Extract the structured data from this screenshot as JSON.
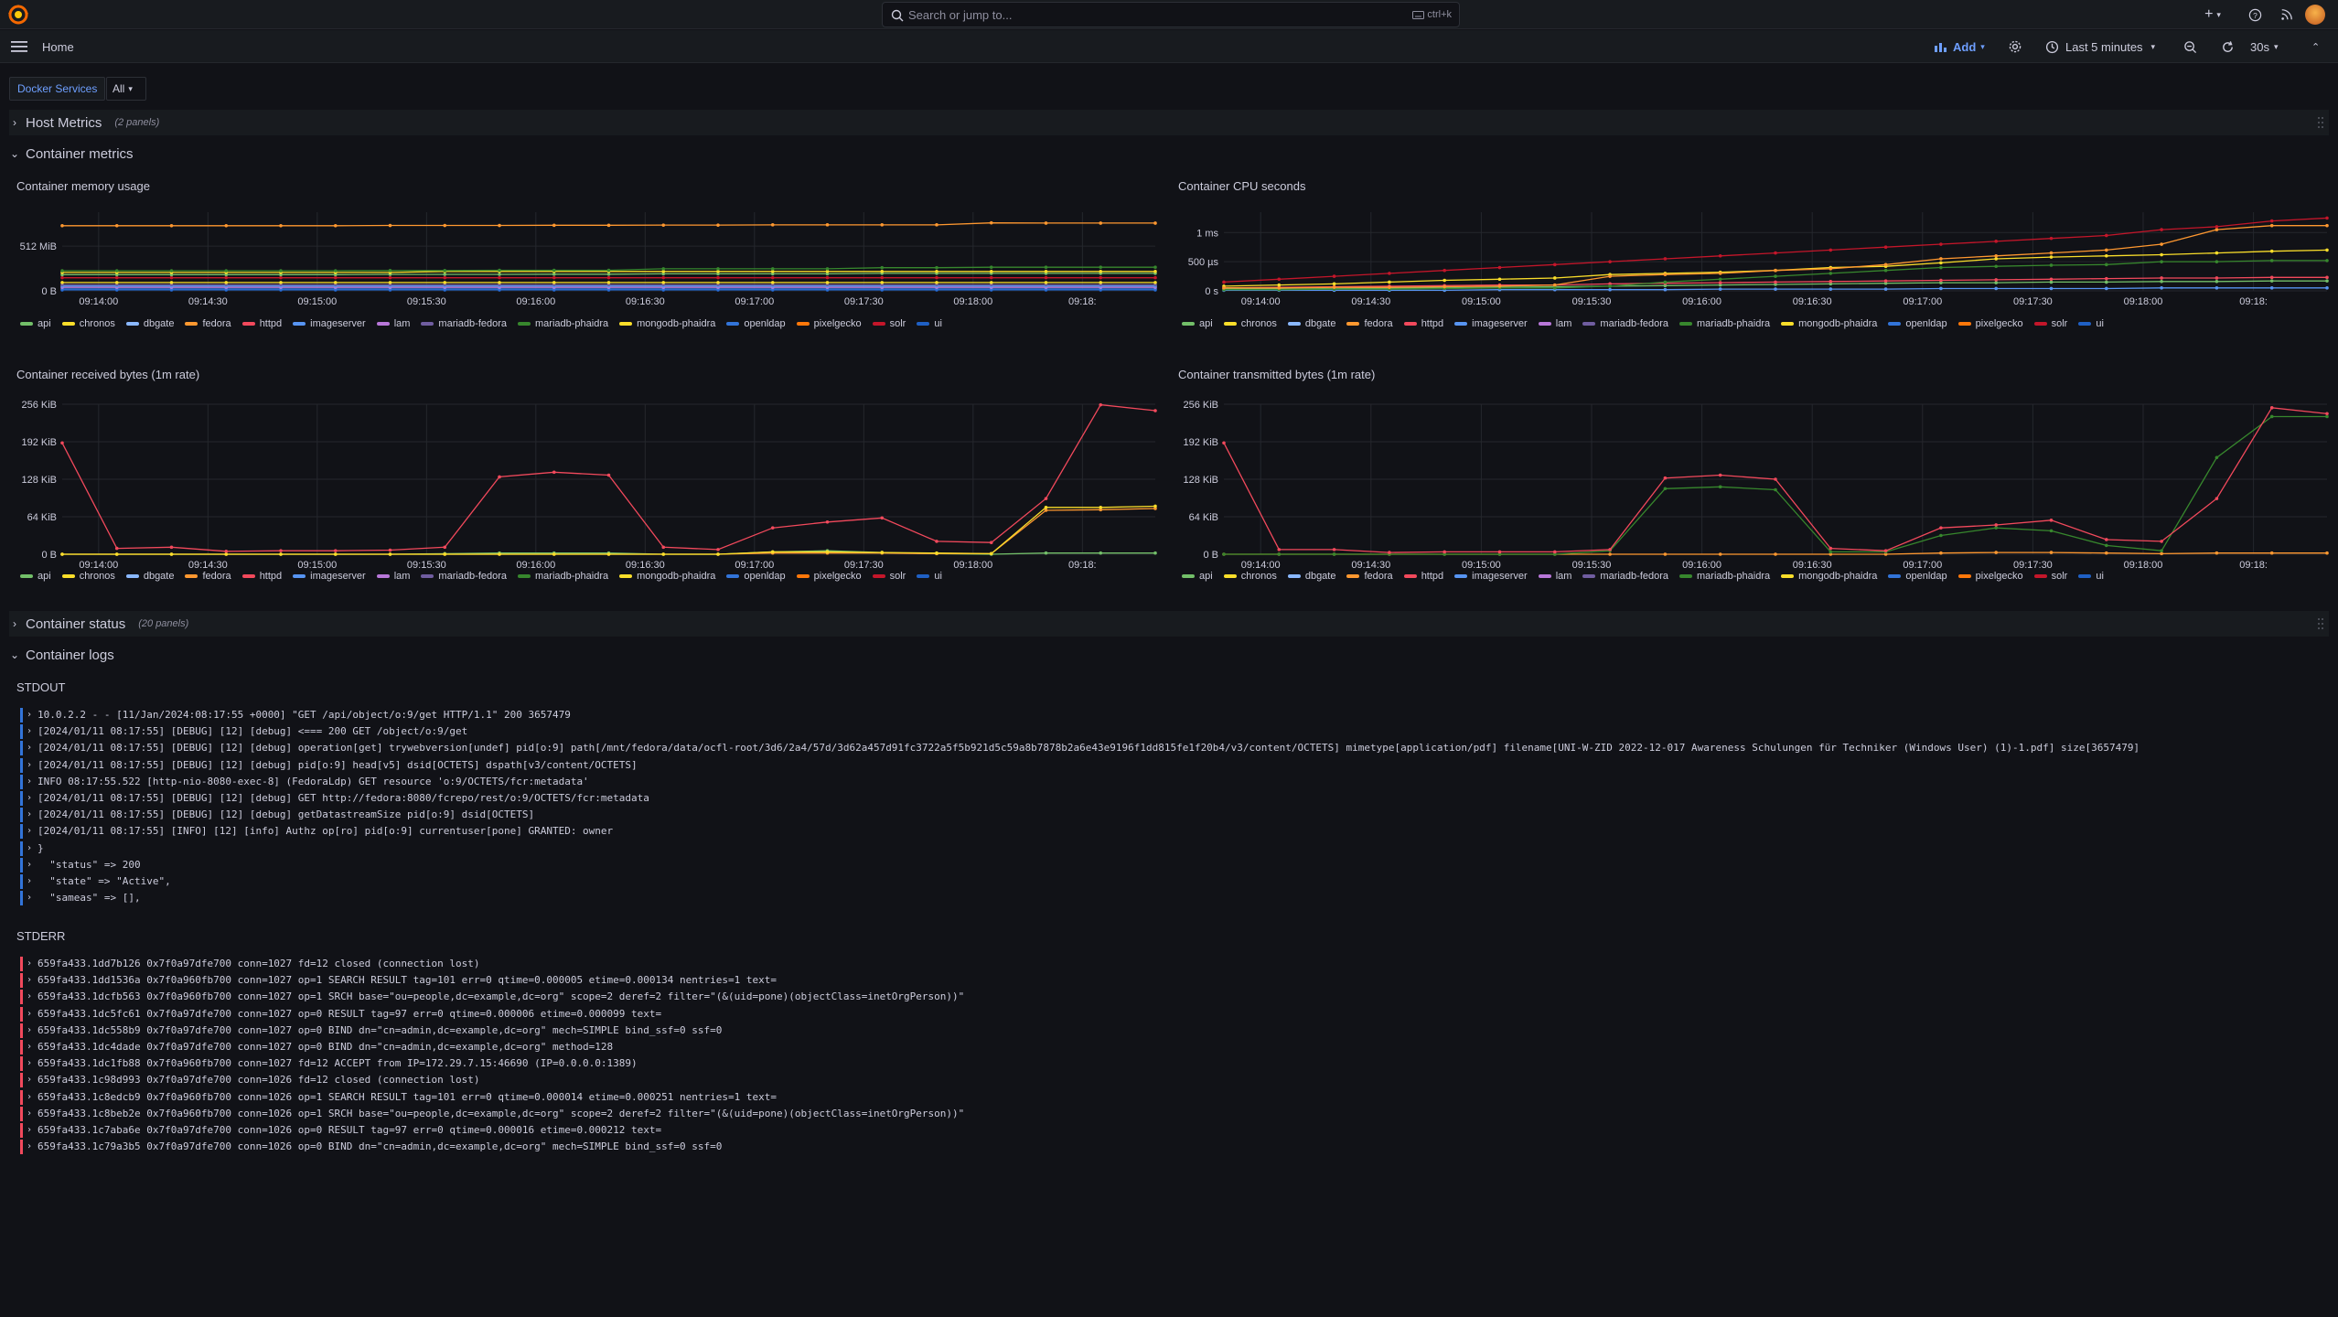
{
  "topbar": {
    "search_placeholder": "Search or jump to...",
    "search_shortcut": "ctrl+k",
    "plus_label": "+"
  },
  "subbar": {
    "breadcrumb": "Home",
    "add_label": "Add",
    "time_range": "Last 5 minutes",
    "refresh_interval": "30s"
  },
  "variables": {
    "label": "Docker Services",
    "value": "All"
  },
  "rows": {
    "host_metrics": {
      "title": "Host Metrics",
      "count": "(2 panels)"
    },
    "container_metrics": {
      "title": "Container metrics"
    },
    "container_status": {
      "title": "Container status",
      "count": "(20 panels)"
    },
    "container_logs": {
      "title": "Container logs"
    }
  },
  "legend": {
    "items": [
      "api",
      "chronos",
      "dbgate",
      "fedora",
      "httpd",
      "imageserver",
      "lam",
      "mariadb-fedora",
      "mariadb-phaidra",
      "mongodb-phaidra",
      "openldap",
      "pixelgecko",
      "solr",
      "ui"
    ],
    "colors": [
      "#73bf69",
      "#fade2a",
      "#8ab8ff",
      "#ff9830",
      "#f2495c",
      "#5794f2",
      "#b877d9",
      "#705da0",
      "#37872d",
      "#fade2a",
      "#3274d9",
      "#ff780a",
      "#c4162a",
      "#1f60c4"
    ]
  },
  "panels": {
    "memory": {
      "title": "Container memory usage"
    },
    "cpu": {
      "title": "Container CPU seconds"
    },
    "received": {
      "title": "Container received bytes (1m rate)"
    },
    "transmitted": {
      "title": "Container transmitted bytes (1m rate)"
    }
  },
  "chart_data": [
    {
      "type": "line",
      "title": "Container memory usage",
      "x": [
        "09:13:50",
        "09:14:05",
        "09:14:20",
        "09:14:35",
        "09:14:50",
        "09:15:05",
        "09:15:20",
        "09:15:35",
        "09:15:50",
        "09:16:05",
        "09:16:20",
        "09:16:35",
        "09:16:50",
        "09:17:05",
        "09:17:20",
        "09:17:35",
        "09:17:50",
        "09:18:05",
        "09:18:20",
        "09:18:35",
        "09:18:50"
      ],
      "xticks": [
        "09:14:00",
        "09:14:30",
        "09:15:00",
        "09:15:30",
        "09:16:00",
        "09:16:30",
        "09:17:00",
        "09:17:30",
        "09:18:00",
        "09:18:"
      ],
      "yticks": [
        "0 B",
        "512 MiB"
      ],
      "ylim": [
        0,
        900
      ],
      "series": [
        {
          "name": "fedora",
          "values": [
            745,
            745,
            745,
            745,
            745,
            745,
            748,
            748,
            748,
            750,
            750,
            752,
            752,
            755,
            755,
            755,
            755,
            778,
            775,
            775,
            775
          ]
        },
        {
          "name": "mariadb-phaidra",
          "values": [
            230,
            230,
            230,
            230,
            230,
            230,
            232,
            232,
            235,
            235,
            235,
            252,
            252,
            252,
            252,
            265,
            265,
            270,
            270,
            270,
            270
          ]
        },
        {
          "name": "mongodb-phaidra",
          "values": [
            210,
            210,
            210,
            210,
            210,
            210,
            210,
            222,
            222,
            222,
            222,
            222,
            222,
            222,
            222,
            222,
            222,
            222,
            222,
            222,
            222
          ]
        },
        {
          "name": "api",
          "values": [
            185,
            185,
            185,
            185,
            185,
            185,
            188,
            188,
            188,
            190,
            190,
            195,
            195,
            195,
            195,
            200,
            200,
            200,
            200,
            200,
            200
          ]
        },
        {
          "name": "solr",
          "values": [
            150,
            150,
            150,
            150,
            150,
            150,
            150,
            150,
            150,
            150,
            150,
            150,
            150,
            150,
            150,
            150,
            150,
            150,
            150,
            150,
            150
          ]
        },
        {
          "name": "chronos",
          "values": [
            95,
            95,
            95,
            95,
            95,
            95,
            95,
            95,
            95,
            95,
            95,
            95,
            95,
            95,
            95,
            95,
            95,
            95,
            95,
            95,
            95
          ]
        },
        {
          "name": "mariadb-fedora",
          "values": [
            72,
            72,
            72,
            72,
            72,
            72,
            72,
            72,
            72,
            72,
            72,
            72,
            72,
            72,
            72,
            72,
            72,
            72,
            72,
            72,
            72
          ]
        },
        {
          "name": "imageserver",
          "values": [
            55,
            55,
            55,
            55,
            55,
            55,
            55,
            55,
            55,
            55,
            55,
            55,
            55,
            55,
            55,
            55,
            55,
            55,
            55,
            55,
            55
          ]
        },
        {
          "name": "lam",
          "values": [
            40,
            40,
            40,
            40,
            40,
            40,
            40,
            40,
            40,
            40,
            40,
            40,
            40,
            40,
            40,
            40,
            40,
            40,
            40,
            40,
            40
          ]
        },
        {
          "name": "openldap",
          "values": [
            22,
            22,
            22,
            22,
            22,
            22,
            22,
            22,
            22,
            22,
            22,
            22,
            22,
            22,
            22,
            22,
            22,
            22,
            22,
            22,
            22
          ]
        },
        {
          "name": "ui",
          "values": [
            10,
            10,
            10,
            10,
            10,
            10,
            10,
            10,
            10,
            10,
            10,
            10,
            10,
            10,
            10,
            10,
            10,
            10,
            10,
            10,
            10
          ]
        }
      ]
    },
    {
      "type": "line",
      "title": "Container CPU seconds",
      "x": [
        "09:13:50",
        "09:14:05",
        "09:14:20",
        "09:14:35",
        "09:14:50",
        "09:15:05",
        "09:15:20",
        "09:15:35",
        "09:15:50",
        "09:16:05",
        "09:16:20",
        "09:16:35",
        "09:16:50",
        "09:17:05",
        "09:17:20",
        "09:17:35",
        "09:17:50",
        "09:18:05",
        "09:18:20",
        "09:18:35",
        "09:18:50"
      ],
      "xticks": [
        "09:14:00",
        "09:14:30",
        "09:15:00",
        "09:15:30",
        "09:16:00",
        "09:16:30",
        "09:17:00",
        "09:17:30",
        "09:18:00",
        "09:18:"
      ],
      "yticks": [
        "0 s",
        "500 µs",
        "1 ms"
      ],
      "ylim": [
        0,
        1.35
      ],
      "series": [
        {
          "name": "solr",
          "values": [
            0.15,
            0.2,
            0.25,
            0.3,
            0.35,
            0.4,
            0.45,
            0.5,
            0.55,
            0.6,
            0.65,
            0.7,
            0.75,
            0.8,
            0.85,
            0.9,
            0.95,
            1.05,
            1.1,
            1.2,
            1.25
          ]
        },
        {
          "name": "fedora",
          "values": [
            0.05,
            0.05,
            0.06,
            0.06,
            0.07,
            0.08,
            0.1,
            0.25,
            0.28,
            0.3,
            0.35,
            0.38,
            0.45,
            0.55,
            0.6,
            0.65,
            0.7,
            0.8,
            1.05,
            1.12,
            1.12
          ]
        },
        {
          "name": "mongodb-phaidra",
          "values": [
            0.08,
            0.1,
            0.12,
            0.15,
            0.18,
            0.2,
            0.22,
            0.28,
            0.3,
            0.32,
            0.35,
            0.4,
            0.42,
            0.48,
            0.55,
            0.58,
            0.6,
            0.62,
            0.65,
            0.68,
            0.7
          ]
        },
        {
          "name": "mariadb-phaidra",
          "values": [
            0.02,
            0.02,
            0.03,
            0.03,
            0.04,
            0.05,
            0.05,
            0.08,
            0.15,
            0.2,
            0.25,
            0.3,
            0.35,
            0.4,
            0.42,
            0.44,
            0.45,
            0.5,
            0.5,
            0.52,
            0.52
          ]
        },
        {
          "name": "httpd",
          "values": [
            0.05,
            0.06,
            0.07,
            0.08,
            0.09,
            0.1,
            0.1,
            0.12,
            0.13,
            0.14,
            0.15,
            0.16,
            0.17,
            0.18,
            0.19,
            0.2,
            0.21,
            0.22,
            0.22,
            0.23,
            0.23
          ]
        },
        {
          "name": "api",
          "values": [
            0.03,
            0.03,
            0.04,
            0.05,
            0.05,
            0.06,
            0.07,
            0.08,
            0.09,
            0.1,
            0.11,
            0.12,
            0.13,
            0.14,
            0.14,
            0.15,
            0.15,
            0.16,
            0.16,
            0.17,
            0.17
          ]
        },
        {
          "name": "imageserver",
          "values": [
            0.01,
            0.01,
            0.01,
            0.01,
            0.01,
            0.02,
            0.02,
            0.02,
            0.02,
            0.03,
            0.03,
            0.03,
            0.03,
            0.04,
            0.04,
            0.04,
            0.04,
            0.05,
            0.05,
            0.05,
            0.05
          ]
        }
      ]
    },
    {
      "type": "line",
      "title": "Container received bytes (1m rate)",
      "x": [
        "09:13:50",
        "09:14:05",
        "09:14:20",
        "09:14:35",
        "09:14:50",
        "09:15:05",
        "09:15:20",
        "09:15:35",
        "09:15:50",
        "09:16:05",
        "09:16:20",
        "09:16:35",
        "09:16:50",
        "09:17:05",
        "09:17:20",
        "09:17:35",
        "09:17:50",
        "09:18:05",
        "09:18:20",
        "09:18:35",
        "09:18:50"
      ],
      "xticks": [
        "09:14:00",
        "09:14:30",
        "09:15:00",
        "09:15:30",
        "09:16:00",
        "09:16:30",
        "09:17:00",
        "09:17:30",
        "09:18:00",
        "09:18:"
      ],
      "yticks": [
        "0 B",
        "64 KiB",
        "128 KiB",
        "192 KiB",
        "256 KiB"
      ],
      "ylim": [
        0,
        256
      ],
      "series": [
        {
          "name": "httpd",
          "values": [
            190,
            10,
            12,
            5,
            6,
            6,
            7,
            12,
            132,
            140,
            135,
            12,
            8,
            45,
            55,
            62,
            22,
            20,
            95,
            255,
            245
          ]
        },
        {
          "name": "mongodb-phaidra",
          "values": [
            0,
            0,
            0,
            0,
            0,
            0,
            0,
            0,
            0,
            0,
            0,
            0,
            0,
            4,
            4,
            3,
            2,
            1,
            80,
            80,
            82
          ]
        },
        {
          "name": "fedora",
          "values": [
            0,
            0,
            0,
            0,
            0,
            0,
            0,
            0,
            0,
            0,
            0,
            0,
            0,
            2,
            2,
            2,
            1,
            1,
            75,
            76,
            78
          ]
        },
        {
          "name": "api",
          "values": [
            0,
            0,
            0,
            0,
            0,
            0,
            0,
            1,
            2,
            2,
            2,
            0,
            0,
            4,
            6,
            3,
            1,
            0,
            2,
            2,
            2
          ]
        }
      ]
    },
    {
      "type": "line",
      "title": "Container transmitted bytes (1m rate)",
      "x": [
        "09:13:50",
        "09:14:05",
        "09:14:20",
        "09:14:35",
        "09:14:50",
        "09:15:05",
        "09:15:20",
        "09:15:35",
        "09:15:50",
        "09:16:05",
        "09:16:20",
        "09:16:35",
        "09:16:50",
        "09:17:05",
        "09:17:20",
        "09:17:35",
        "09:17:50",
        "09:18:05",
        "09:18:20",
        "09:18:35",
        "09:18:50"
      ],
      "xticks": [
        "09:14:00",
        "09:14:30",
        "09:15:00",
        "09:15:30",
        "09:16:00",
        "09:16:30",
        "09:17:00",
        "09:17:30",
        "09:18:00",
        "09:18:"
      ],
      "yticks": [
        "0 B",
        "64 KiB",
        "128 KiB",
        "192 KiB",
        "256 KiB"
      ],
      "ylim": [
        0,
        256
      ],
      "series": [
        {
          "name": "httpd",
          "values": [
            190,
            8,
            8,
            3,
            4,
            4,
            4,
            8,
            130,
            135,
            128,
            10,
            6,
            45,
            50,
            58,
            25,
            22,
            95,
            250,
            240
          ]
        },
        {
          "name": "mariadb-phaidra",
          "values": [
            0,
            0,
            0,
            0,
            0,
            0,
            0,
            6,
            112,
            115,
            110,
            4,
            4,
            32,
            45,
            40,
            15,
            6,
            165,
            235,
            235
          ]
        },
        {
          "name": "fedora",
          "values": [
            0,
            0,
            0,
            0,
            0,
            0,
            0,
            0,
            0,
            0,
            0,
            0,
            0,
            2,
            3,
            3,
            2,
            1,
            2,
            2,
            2
          ]
        }
      ]
    }
  ],
  "logs": {
    "stdout_title": "STDOUT",
    "stderr_title": "STDERR",
    "stdout": [
      "10.0.2.2 - - [11/Jan/2024:08:17:55 +0000] \"GET /api/object/o:9/get HTTP/1.1\" 200 3657479",
      "[2024/01/11 08:17:55] [DEBUG] [12] [debug] <=== 200 GET /object/o:9/get",
      "[2024/01/11 08:17:55] [DEBUG] [12] [debug] operation[get] trywebversion[undef] pid[o:9] path[/mnt/fedora/data/ocfl-root/3d6/2a4/57d/3d62a457d91fc3722a5f5b921d5c59a8b7878b2a6e43e9196f1dd815fe1f20b4/v3/content/OCTETS] mimetype[application/pdf] filename[UNI-W-ZID 2022-12-017 Awareness Schulungen für Techniker (Windows User) (1)-1.pdf] size[3657479]",
      "[2024/01/11 08:17:55] [DEBUG] [12] [debug] pid[o:9] head[v5] dsid[OCTETS] dspath[v3/content/OCTETS]",
      "INFO 08:17:55.522 [http-nio-8080-exec-8] (FedoraLdp) GET resource 'o:9/OCTETS/fcr:metadata'",
      "[2024/01/11 08:17:55] [DEBUG] [12] [debug] GET http://fedora:8080/fcrepo/rest/o:9/OCTETS/fcr:metadata",
      "[2024/01/11 08:17:55] [DEBUG] [12] [debug] getDatastreamSize pid[o:9] dsid[OCTETS]",
      "[2024/01/11 08:17:55] [INFO] [12] [info] Authz op[ro] pid[o:9] currentuser[pone] GRANTED: owner",
      "}",
      "  \"status\" => 200",
      "  \"state\" => \"Active\",",
      "  \"sameas\" => [],"
    ],
    "stderr": [
      "659fa433.1dd7b126 0x7f0a97dfe700 conn=1027 fd=12 closed (connection lost)",
      "659fa433.1dd1536a 0x7f0a960fb700 conn=1027 op=1 SEARCH RESULT tag=101 err=0 qtime=0.000005 etime=0.000134 nentries=1 text=",
      "659fa433.1dcfb563 0x7f0a960fb700 conn=1027 op=1 SRCH base=\"ou=people,dc=example,dc=org\" scope=2 deref=2 filter=\"(&(uid=pone)(objectClass=inetOrgPerson))\"",
      "659fa433.1dc5fc61 0x7f0a97dfe700 conn=1027 op=0 RESULT tag=97 err=0 qtime=0.000006 etime=0.000099 text=",
      "659fa433.1dc558b9 0x7f0a97dfe700 conn=1027 op=0 BIND dn=\"cn=admin,dc=example,dc=org\" mech=SIMPLE bind_ssf=0 ssf=0",
      "659fa433.1dc4dade 0x7f0a97dfe700 conn=1027 op=0 BIND dn=\"cn=admin,dc=example,dc=org\" method=128",
      "659fa433.1dc1fb88 0x7f0a960fb700 conn=1027 fd=12 ACCEPT from IP=172.29.7.15:46690 (IP=0.0.0.0:1389)",
      "659fa433.1c98d993 0x7f0a97dfe700 conn=1026 fd=12 closed (connection lost)",
      "659fa433.1c8edcb9 0x7f0a960fb700 conn=1026 op=1 SEARCH RESULT tag=101 err=0 qtime=0.000014 etime=0.000251 nentries=1 text=",
      "659fa433.1c8beb2e 0x7f0a960fb700 conn=1026 op=1 SRCH base=\"ou=people,dc=example,dc=org\" scope=2 deref=2 filter=\"(&(uid=pone)(objectClass=inetOrgPerson))\"",
      "659fa433.1c7aba6e 0x7f0a97dfe700 conn=1026 op=0 RESULT tag=97 err=0 qtime=0.000016 etime=0.000212 text=",
      "659fa433.1c79a3b5 0x7f0a97dfe700 conn=1026 op=0 BIND dn=\"cn=admin,dc=example,dc=org\" mech=SIMPLE bind_ssf=0 ssf=0"
    ],
    "stdout_bar_color": "#3274d9",
    "stderr_bar_color": "#f2495c"
  }
}
